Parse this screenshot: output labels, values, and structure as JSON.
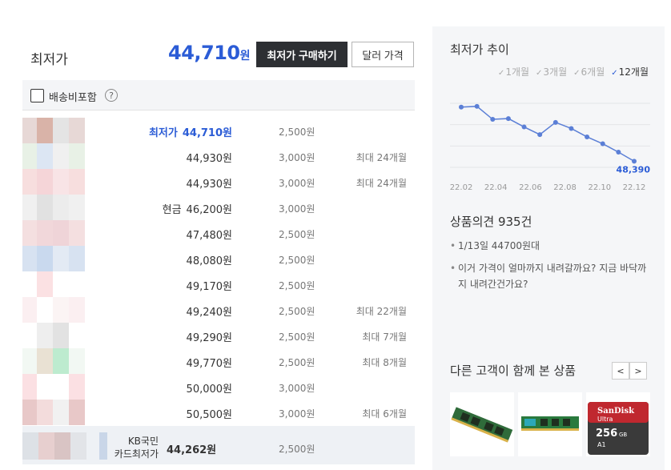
{
  "header": {
    "lowest_label": "최저가",
    "lowest_price": "44,710",
    "won": "원",
    "buy_button": "최저가 구매하기",
    "dollar_button": "달러 가격"
  },
  "shipping_filter": {
    "label": "배송비포함",
    "help": "?"
  },
  "sellers": [
    {
      "prefix": "최저가",
      "price": "44,710원",
      "shipping": "2,500원",
      "installment": "",
      "best": true
    },
    {
      "prefix": "",
      "price": "44,930원",
      "shipping": "3,000원",
      "installment": "최대 24개월"
    },
    {
      "prefix": "",
      "price": "44,930원",
      "shipping": "3,000원",
      "installment": "최대 24개월"
    },
    {
      "prefix": "현금",
      "price": "46,200원",
      "shipping": "3,000원",
      "installment": ""
    },
    {
      "prefix": "",
      "price": "47,480원",
      "shipping": "2,500원",
      "installment": ""
    },
    {
      "prefix": "",
      "price": "48,080원",
      "shipping": "2,500원",
      "installment": ""
    },
    {
      "prefix": "",
      "price": "49,170원",
      "shipping": "2,500원",
      "installment": ""
    },
    {
      "prefix": "",
      "price": "49,240원",
      "shipping": "2,500원",
      "installment": "최대 22개월"
    },
    {
      "prefix": "",
      "price": "49,290원",
      "shipping": "2,500원",
      "installment": "최대 7개월"
    },
    {
      "prefix": "",
      "price": "49,770원",
      "shipping": "2,500원",
      "installment": "최대 8개월"
    },
    {
      "prefix": "",
      "price": "50,000원",
      "shipping": "3,000원",
      "installment": ""
    },
    {
      "prefix": "",
      "price": "50,500원",
      "shipping": "3,000원",
      "installment": "최대 6개월"
    }
  ],
  "card_row": {
    "name_line1": "KB국민",
    "name_line2": "카드최저가",
    "price": "44,262원",
    "shipping": "2,500원"
  },
  "trend": {
    "title": "최저가 추이",
    "periods": [
      {
        "label": "1개월",
        "active": false
      },
      {
        "label": "3개월",
        "active": false
      },
      {
        "label": "6개월",
        "active": false
      },
      {
        "label": "12개월",
        "active": true
      }
    ],
    "check_mark": "✓"
  },
  "chart_data": {
    "type": "line",
    "x_ticks": [
      "22.02",
      "22.04",
      "22.06",
      "22.08",
      "22.10",
      "22.12"
    ],
    "values": [
      51800,
      51900,
      50200,
      50300,
      49200,
      48200,
      49800,
      49000,
      47900,
      47000,
      45900,
      44710
    ],
    "last_label": "48,390",
    "color": "#5b7fd6",
    "grid": true
  },
  "opinion": {
    "title": "상품의견 935건",
    "items": [
      "1/13일 44700원대",
      "이거 가격이 얼마까지 내려갈까요? 지금 바닥까지 내려간건가요?"
    ]
  },
  "also_viewed": {
    "title": "다른 고객이 함께 본 상품",
    "prev": "<",
    "next": ">",
    "sd_brand": "SanDisk",
    "sd_line": "Ultra",
    "sd_capacity": "256",
    "sd_unit": "GB",
    "sd_class": "A1"
  },
  "colors": {
    "accent": "#2b5cd6",
    "dark_button": "#2d2f33"
  }
}
